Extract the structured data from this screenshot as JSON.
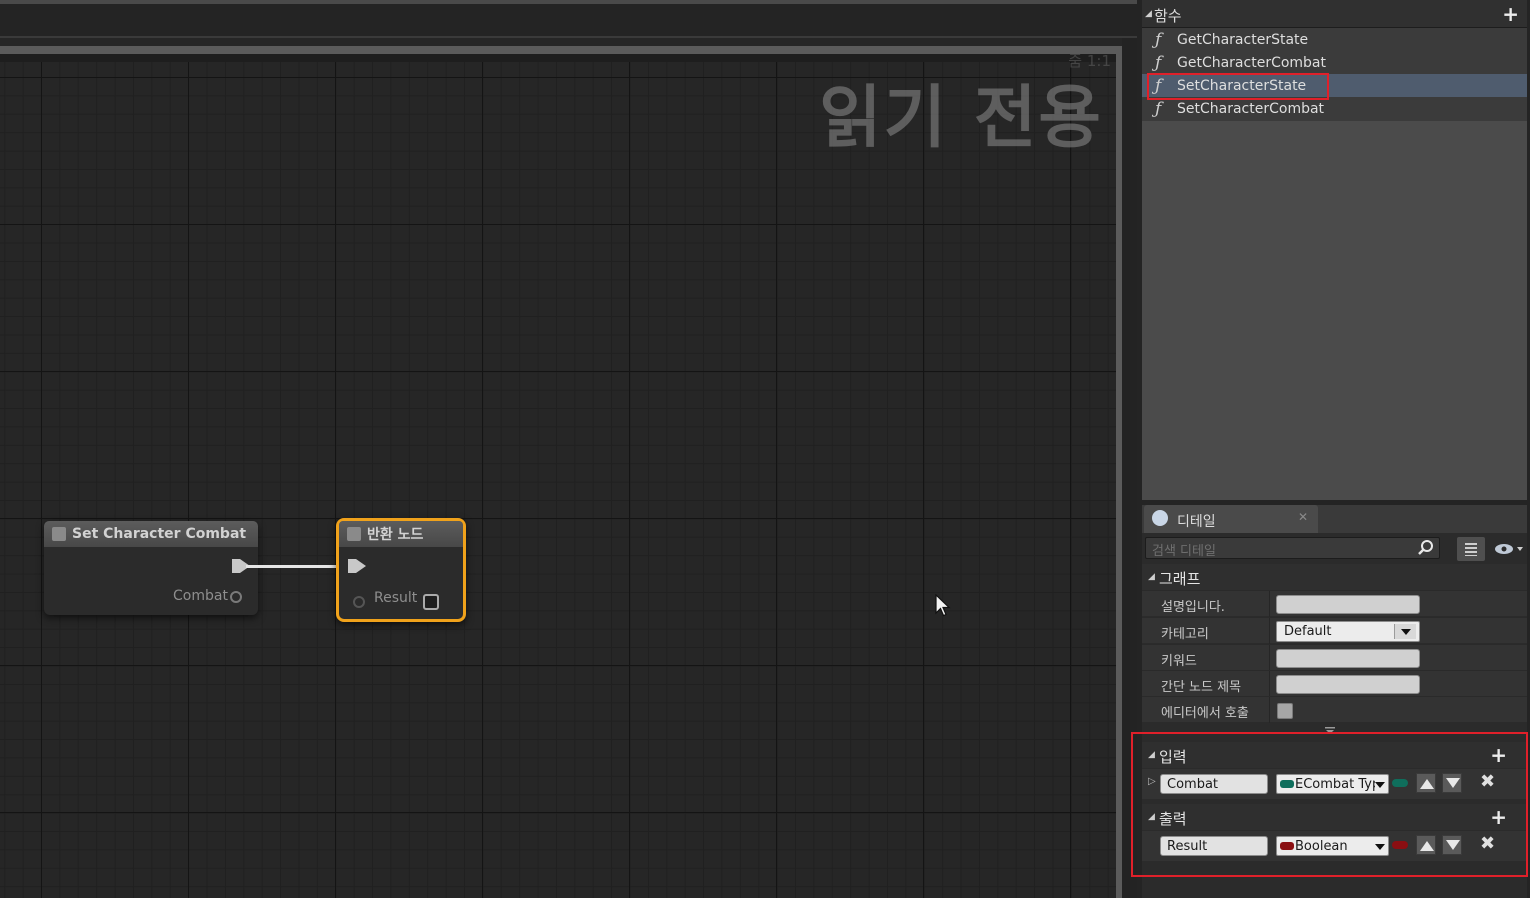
{
  "graph": {
    "watermark": "읽기 전용",
    "watermark_small": "줌 1:1",
    "nodes": {
      "set": {
        "title": "Set Character Combat",
        "out_label": "Combat"
      },
      "ret": {
        "title": "반환 노드",
        "in_label": "Result"
      }
    }
  },
  "functions": {
    "title": "함수",
    "items": [
      {
        "label": "GetCharacterState"
      },
      {
        "label": "GetCharacterCombat"
      },
      {
        "label": "SetCharacterState"
      },
      {
        "label": "SetCharacterCombat"
      }
    ]
  },
  "details": {
    "tab_label": "디테일",
    "search_placeholder": "검색 디테일",
    "graph_section": {
      "title": "그래프",
      "rows": [
        {
          "label": "설명입니다."
        },
        {
          "label": "카테고리",
          "value": "Default"
        },
        {
          "label": "키워드"
        },
        {
          "label": "간단 노드 제목"
        },
        {
          "label": "에디터에서 호출"
        }
      ]
    },
    "inputs": {
      "title": "입력",
      "params": [
        {
          "name": "Combat",
          "type": "ECombat Typ",
          "type_color": "#0f6e5c"
        }
      ]
    },
    "outputs": {
      "title": "출력",
      "params": [
        {
          "name": "Result",
          "type": "Boolean",
          "type_color": "#8a0f12"
        }
      ]
    }
  },
  "colors": {
    "highlight": "#e0202a",
    "selected_node": "#f0a21b"
  }
}
